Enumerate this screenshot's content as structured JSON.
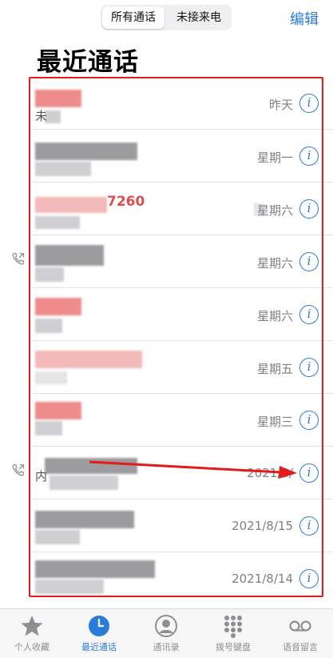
{
  "header": {
    "segment_all": "所有通话",
    "segment_missed": "未接来电",
    "edit_label": "编辑",
    "title": "最近通话"
  },
  "calls": [
    {
      "time": "昨天",
      "partial": "未",
      "name_color": "red"
    },
    {
      "time": "星期一",
      "partial": "",
      "name_color": "gray"
    },
    {
      "time": "星期六",
      "partial": "7260",
      "name_color": "red"
    },
    {
      "time": "星期六",
      "partial": "",
      "name_color": "gray",
      "outgoing_icon": true
    },
    {
      "time": "星期六",
      "partial": "",
      "name_color": "red"
    },
    {
      "time": "星期五",
      "partial": "",
      "name_color": "red"
    },
    {
      "time": "星期三",
      "partial": "",
      "name_color": "red"
    },
    {
      "time": "2021/8/",
      "partial": "内",
      "name_color": "gray",
      "outgoing_icon": true
    },
    {
      "time": "2021/8/15",
      "partial": "",
      "name_color": "gray"
    },
    {
      "time": "2021/8/14",
      "partial": "",
      "name_color": "gray"
    }
  ],
  "tabbar": [
    {
      "label": "个人收藏",
      "icon": "star-icon"
    },
    {
      "label": "最近通话",
      "icon": "clock-icon",
      "active": true
    },
    {
      "label": "通讯录",
      "icon": "contact-icon"
    },
    {
      "label": "拨号键盘",
      "icon": "keypad-icon"
    },
    {
      "label": "语音留言",
      "icon": "voicemail-icon"
    }
  ],
  "colors": {
    "accent": "#2b7bd8",
    "annotation_red": "#e21b1b",
    "missed_red": "#e24b4b"
  }
}
